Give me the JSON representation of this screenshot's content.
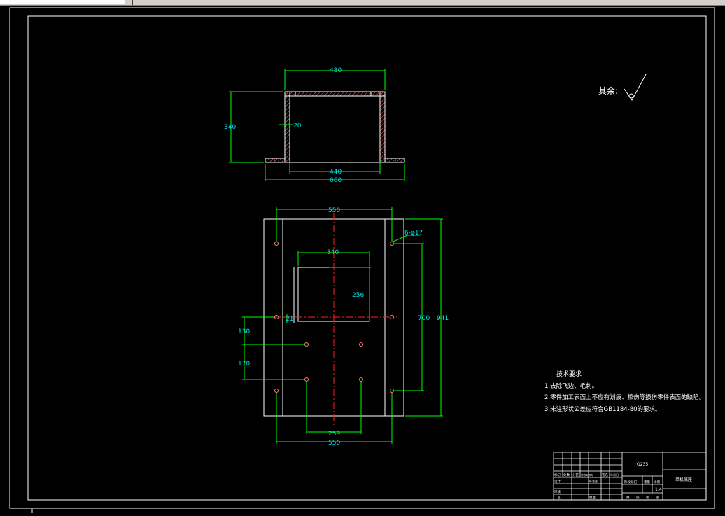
{
  "toolbar": {
    "text_input_value": "",
    "dropdown_value": ""
  },
  "drawing": {
    "roughness_label": "其余:",
    "colors": {
      "background": "#000000",
      "frame": "#ffffff",
      "dimension": "#00ff00",
      "dimension_text": "#00e5e5",
      "centerline": "#ff0000",
      "hatch": "#ff7070"
    },
    "front_view": {
      "dim_top_width": "480",
      "dim_height": "340",
      "dim_wall": "20",
      "dim_inner_width": "440",
      "dim_base_width": "660"
    },
    "plan_view": {
      "dim_top_width": "550",
      "dim_window_width": "340",
      "dim_window_height": "256",
      "dim_hole_callout": "6-φ17",
      "dim_mid_height": "700",
      "dim_total_height": "941",
      "dim_left_130": "130",
      "dim_left_170": "170",
      "dim_bottom_259": "259",
      "dim_bottom_width": "550",
      "dim_small": "21"
    },
    "tech_requirements": {
      "title": "技术要求",
      "items": [
        "1.去除飞边、毛刺。",
        "2.零件加工表面上不应有划痕、擦伤等损伤零件表面的缺陷。",
        "3.未注形状公差应符合GB1184-80的要求。"
      ]
    },
    "title_block": {
      "material": "Q235",
      "part_name": "单机底座",
      "scale": "1:4",
      "row_labels": [
        "标记",
        "处数",
        "分区",
        "更改文件号",
        "签名",
        "年月日"
      ],
      "design_label": "设计",
      "standardize_label": "标准化",
      "review_label": "审核",
      "process_label": "工艺",
      "approve_label": "批准",
      "stage_label": "阶段标记",
      "weight_label": "重量",
      "scale_label": "比例",
      "sheet_labels": [
        "共",
        "张",
        "第",
        "张"
      ]
    }
  }
}
